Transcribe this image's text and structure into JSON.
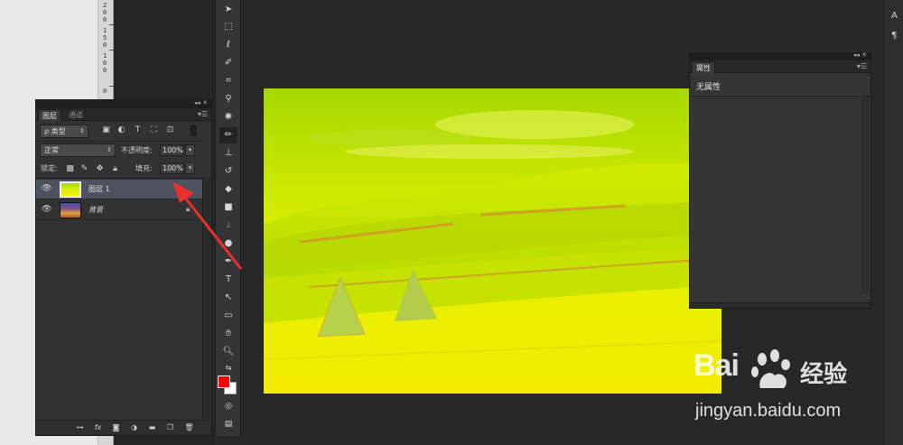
{
  "ruler": {
    "numbers": [
      "200",
      "150",
      "100",
      "0"
    ]
  },
  "layers_panel": {
    "tabs": [
      "图层",
      "通道"
    ],
    "filter": {
      "label": "ρ 类型"
    },
    "blend_mode": "正常",
    "opacity_label": "不透明度:",
    "opacity_value": "100%",
    "lock_label": "锁定:",
    "fill_label": "填充:",
    "fill_value": "100%",
    "layers": [
      {
        "name": "图层 1",
        "selected": true,
        "visible": true,
        "locked": false
      },
      {
        "name": "背景",
        "selected": false,
        "visible": true,
        "locked": true
      }
    ],
    "bottom_icons": [
      "link-icon",
      "fx-icon",
      "mask-icon",
      "adjustment-icon",
      "group-icon",
      "new-layer-icon",
      "trash-icon"
    ],
    "fx_label": "fx"
  },
  "toolbar": {
    "active_tool": "brush-tool",
    "foreground_color": "#ff0000",
    "background_color": "#ffffff"
  },
  "properties_panel": {
    "tab": "属性",
    "content": "无属性"
  },
  "right_dock": {
    "items": [
      "A",
      "¶"
    ]
  },
  "watermark": {
    "logo_text": "Bai",
    "logo_text_cn": "经验",
    "url": "jingyan.baidu.com"
  },
  "colors": {
    "canvas_primary": "#c8e000",
    "annotation_arrow": "#e8312e",
    "selection": "#4c5260"
  }
}
